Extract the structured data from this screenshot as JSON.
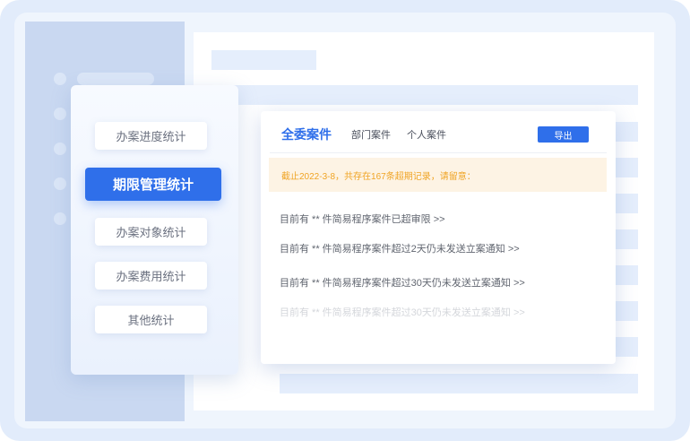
{
  "menu": {
    "items": [
      {
        "label": "办案进度统计",
        "active": false
      },
      {
        "label": "期限管理统计",
        "active": true
      },
      {
        "label": "办案对象统计",
        "active": false
      },
      {
        "label": "办案费用统计",
        "active": false
      },
      {
        "label": "其他统计",
        "active": false
      }
    ]
  },
  "main": {
    "tabs": [
      {
        "label": "全委案件",
        "active": true
      },
      {
        "label": "部门案件",
        "active": false
      },
      {
        "label": "个人案件",
        "active": false
      }
    ],
    "export_label": "导出",
    "notice": "截止2022-3-8，共存在167条超期记录，请留意：",
    "rows": [
      "目前有 ** 件简易程序案件已超审限 >>",
      "目前有 ** 件简易程序案件超过2天仍未发送立案通知  >>",
      "目前有 ** 件简易程序案件超过30天仍未发送立案通知  >>",
      "目前有 ** 件简易程序案件超过30天仍未发送立案通知  >>"
    ]
  },
  "colors": {
    "accent": "#2f6fea",
    "notice_bg": "#fdf3e4",
    "notice_text": "#f0a425",
    "frame": "#e2ecfb"
  }
}
